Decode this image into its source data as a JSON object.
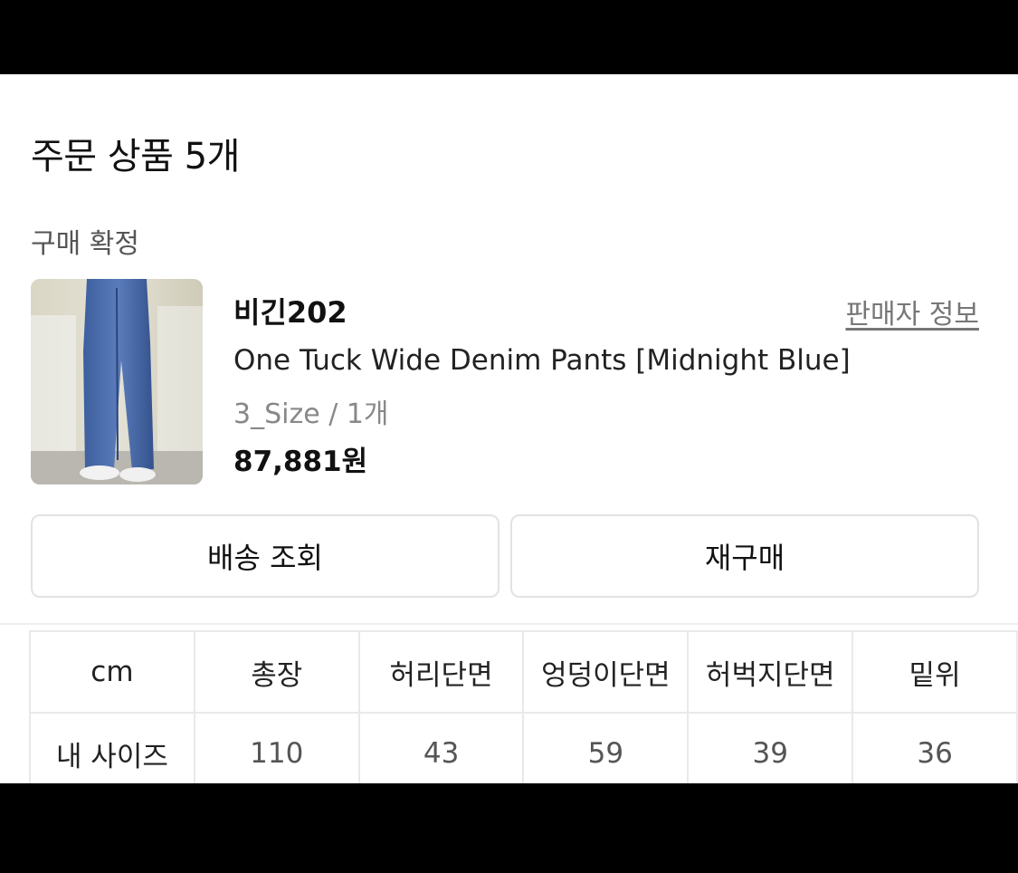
{
  "order": {
    "section_title": "주문 상품 5개",
    "status": "구매 확정"
  },
  "product": {
    "image_icon": "denim-pants-photo",
    "brand": "비긴202",
    "seller_link": "판매자 정보",
    "name": "One Tuck Wide Denim Pants [Midnight Blue]",
    "option": "3_Size / 1개",
    "price": "87,881원"
  },
  "actions": {
    "track": "배송 조회",
    "rebuy": "재구매"
  },
  "size_table": {
    "headers": [
      "cm",
      "총장",
      "허리단면",
      "엉덩이단면",
      "허벅지단면",
      "밑위"
    ],
    "rows": [
      [
        "내 사이즈",
        "110",
        "43",
        "59",
        "39",
        "36"
      ]
    ]
  },
  "colors": {
    "background": "#ffffff",
    "letterbox": "#000000",
    "border": "#e2e2e2",
    "muted_text": "#888888"
  }
}
